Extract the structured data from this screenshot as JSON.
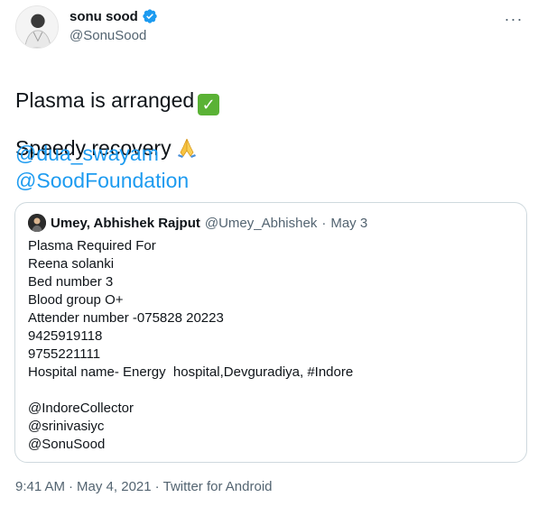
{
  "author": {
    "display_name": "sonu sood",
    "handle": "@SonuSood",
    "verified": true
  },
  "icons": {
    "more": "more-horizontal-icon",
    "verified": "verified-badge-icon",
    "check": "check-mark-emoji",
    "pray": "folded-hands-emoji"
  },
  "tweet": {
    "line1": "Plasma is arranged",
    "line2": "Speedy recovery",
    "mention1": "@dua_swayam",
    "mention2": "@SoodFoundation"
  },
  "quote": {
    "name": "Umey, Abhishek Rajput",
    "handle": "@Umey_Abhishek",
    "separator": "·",
    "date": "May 3",
    "lines": [
      "Plasma Required For",
      "Reena solanki",
      "Bed number 3",
      "Blood group O+",
      "Attender number -075828 20223",
      "9425919118",
      "9755221111",
      "Hospital name- Energy  hospital,Devguradiya, #Indore",
      "",
      "@IndoreCollector",
      "@srinivasiyc",
      "@SonuSood"
    ]
  },
  "meta": {
    "time": "9:41 AM",
    "sep1": "·",
    "date": "May 4, 2021",
    "sep2": "·",
    "source": "Twitter for Android"
  },
  "colors": {
    "link": "#1d9bf0",
    "muted": "#536471",
    "text": "#0f1419",
    "border": "#cfd9de"
  }
}
